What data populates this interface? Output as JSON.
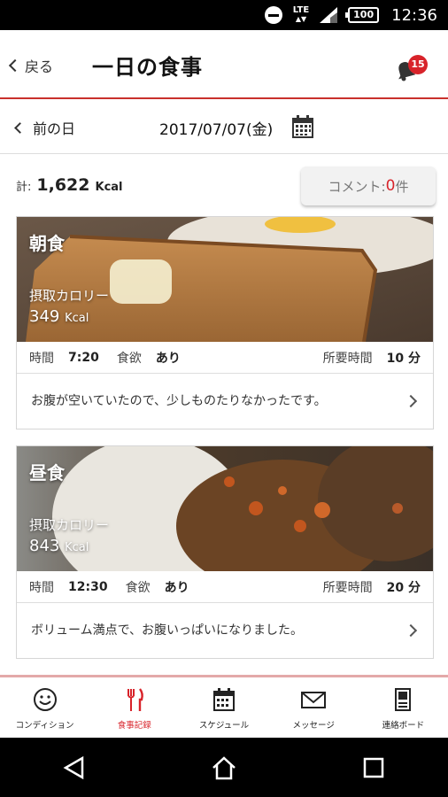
{
  "statusbar": {
    "network": "LTE",
    "battery": "100",
    "time": "12:36"
  },
  "header": {
    "back_label": "戻る",
    "title": "一日の食事",
    "notification_count": "15"
  },
  "datebar": {
    "prev_label": "前の日",
    "date": "2017/07/07(金)"
  },
  "summary": {
    "total_prefix": "計:",
    "total_value": "1,622",
    "total_unit": "Kcal",
    "comment_label": "コメント:",
    "comment_count": "0",
    "comment_suffix": "件"
  },
  "meals": [
    {
      "title": "朝食",
      "calorie_label": "摂取カロリー",
      "calorie_value": "349",
      "calorie_unit": "Kcal",
      "time_label": "時間",
      "time_value": "7:20",
      "appetite_label": "食欲",
      "appetite_value": "あり",
      "duration_label": "所要時間",
      "duration_value": "10 分",
      "memo": "お腹が空いていたので、少しものたりなかったです。"
    },
    {
      "title": "昼食",
      "calorie_label": "摂取カロリー",
      "calorie_value": "843",
      "calorie_unit": "Kcal",
      "time_label": "時間",
      "time_value": "12:30",
      "appetite_label": "食欲",
      "appetite_value": "あり",
      "duration_label": "所要時間",
      "duration_value": "20 分",
      "memo": "ボリューム満点で、お腹いっぱいになりました。"
    }
  ],
  "tabs": [
    {
      "label": "コンディション",
      "icon": "smiley-icon"
    },
    {
      "label": "食事記録",
      "icon": "fork-knife-icon"
    },
    {
      "label": "スケジュール",
      "icon": "calendar-icon"
    },
    {
      "label": "メッセージ",
      "icon": "envelope-icon"
    },
    {
      "label": "連絡ボード",
      "icon": "board-icon"
    }
  ],
  "colors": {
    "accent": "#d8232a",
    "header_rule": "#c9302c"
  }
}
